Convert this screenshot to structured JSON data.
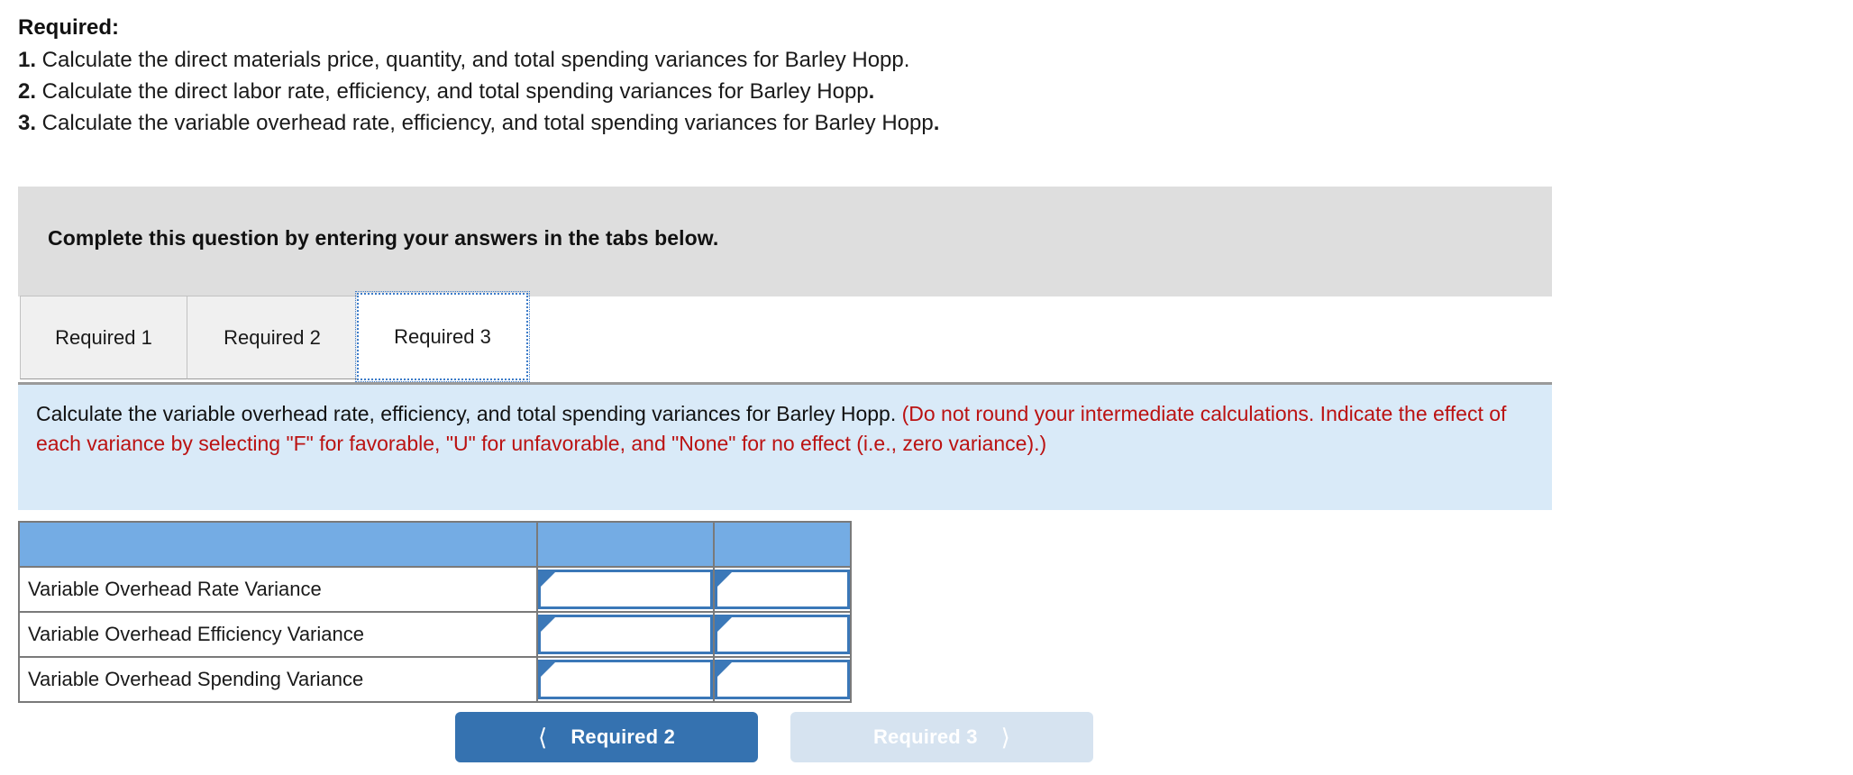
{
  "required": {
    "heading": "Required:",
    "items": [
      {
        "num": "1.",
        "text": " Calculate the direct materials price, quantity, and total spending variances for Barley Hopp.",
        "tail_bold": ""
      },
      {
        "num": "2.",
        "text": " Calculate the direct labor rate, efficiency, and total spending variances for Barley Hopp",
        "tail_bold": "."
      },
      {
        "num": "3.",
        "text": " Calculate the variable overhead rate, efficiency, and total spending variances for Barley Hopp",
        "tail_bold": "."
      }
    ]
  },
  "instruction_bar": {
    "text": "Complete this question by entering your answers in the tabs below."
  },
  "tabs": [
    {
      "label": "Required 1",
      "active": false
    },
    {
      "label": "Required 2",
      "active": false
    },
    {
      "label": "Required 3",
      "active": true
    }
  ],
  "panel": {
    "black_text": "Calculate the variable overhead rate, efficiency, and total spending variances for Barley Hopp. ",
    "red_text": "(Do not round your intermediate calculations. Indicate the effect of each variance by selecting \"F\" for favorable, \"U\" for unfavorable, and \"None\" for no effect (i.e., zero variance).)"
  },
  "table": {
    "header": [
      "",
      "",
      ""
    ],
    "rows": [
      {
        "label": "Variable Overhead Rate Variance",
        "amount": "",
        "effect": ""
      },
      {
        "label": "Variable Overhead Efficiency Variance",
        "amount": "",
        "effect": ""
      },
      {
        "label": "Variable Overhead Spending Variance",
        "amount": "",
        "effect": ""
      }
    ]
  },
  "nav": {
    "prev_label": "Required 2",
    "prev_icon": "chevron-left-icon",
    "next_label": "Required 3",
    "next_icon": "chevron-right-icon"
  },
  "colors": {
    "header_blue": "#74ace4",
    "panel_blue": "#d9eaf8",
    "gray_bar": "#dedede",
    "input_border": "#3b78b8",
    "button_blue": "#3572b0",
    "button_disabled": "#d6e3f0",
    "red_text": "#bb1212"
  }
}
